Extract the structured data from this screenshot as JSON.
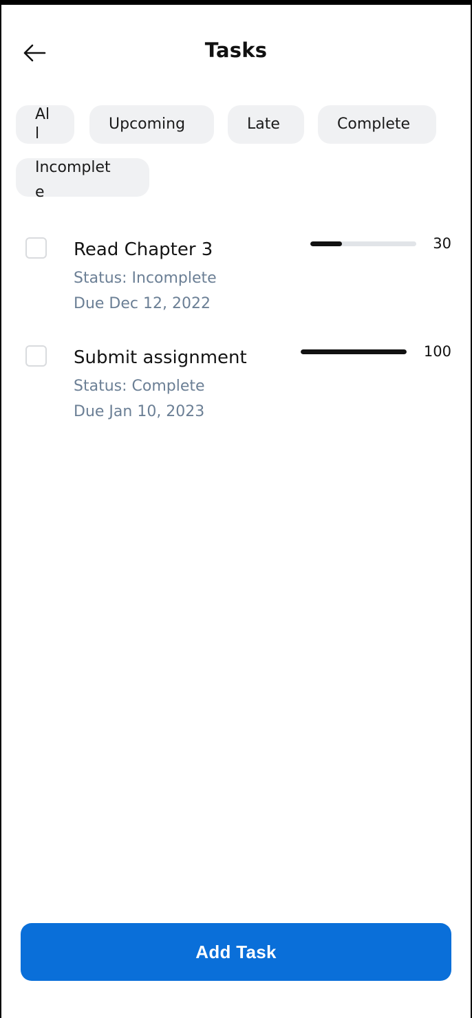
{
  "header": {
    "title": "Tasks",
    "back_icon": "arrow-left-icon"
  },
  "filters": {
    "chips": [
      {
        "label": "All"
      },
      {
        "label": "Upcoming"
      },
      {
        "label": "Late"
      },
      {
        "label": "Complete"
      },
      {
        "label": "Incomplete"
      }
    ]
  },
  "tasks": [
    {
      "name": "Read Chapter 3",
      "status": "Status: Incomplete",
      "due": "Due Dec 12, 2022",
      "progress": 30,
      "progress_label": "30"
    },
    {
      "name": "Submit assignment",
      "status": "Status: Complete",
      "due": "Due Jan 10, 2023",
      "progress": 100,
      "progress_label": "100"
    }
  ],
  "footer": {
    "add_label": "Add Task"
  },
  "colors": {
    "accent": "#0a6fd9",
    "chip_bg": "#f0f1f3",
    "secondary_text": "#6b7f95",
    "progress_fill": "#111111",
    "progress_track": "#e1e4e8"
  }
}
